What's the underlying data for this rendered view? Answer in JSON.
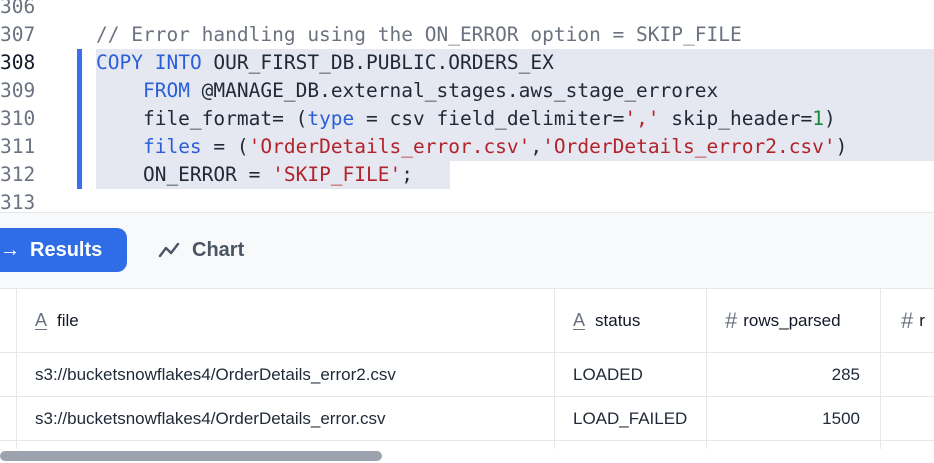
{
  "editor": {
    "lines": [
      {
        "num": "306",
        "text": ""
      },
      {
        "num": "307",
        "text": "// Error handling using the ON_ERROR option = SKIP_FILE"
      },
      {
        "num": "308",
        "p1": "COPY",
        "p2": " ",
        "p3": "INTO",
        "p4": " OUR_FIRST_DB.PUBLIC.ORDERS_EX"
      },
      {
        "num": "309",
        "p1": "    ",
        "p2": "FROM",
        "p3": " @MANAGE_DB.external_stages.aws_stage_errorex"
      },
      {
        "num": "310",
        "p1": "    file_format= (",
        "p2": "type",
        "p3": " = csv field_delimiter=",
        "p4": "','",
        "p5": " skip_header=",
        "p6": "1",
        "p7": ")"
      },
      {
        "num": "311",
        "p1": "    ",
        "p2": "files",
        "p3": " = (",
        "p4": "'OrderDetails_error.csv'",
        "p5": ",",
        "p6": "'OrderDetails_error2.csv'",
        "p7": ")"
      },
      {
        "num": "312",
        "p1": "    ON_ERROR = ",
        "p2": "'SKIP_FILE'",
        "p3": ";"
      },
      {
        "num": "313",
        "text": ""
      }
    ]
  },
  "results_panel": {
    "tabs": {
      "results": "Results",
      "results_icon": "→",
      "chart": "Chart"
    },
    "columns": [
      {
        "type_icon": "A",
        "name": "file"
      },
      {
        "type_icon": "A",
        "name": "status"
      },
      {
        "type_icon": "#",
        "name": "rows_parsed"
      },
      {
        "type_icon": "#",
        "name": "r"
      }
    ],
    "rows": [
      {
        "file": "s3://bucketsnowflakes4/OrderDetails_error2.csv",
        "status": "LOADED",
        "rows_parsed": "285"
      },
      {
        "file": "s3://bucketsnowflakes4/OrderDetails_error.csv",
        "status": "LOAD_FAILED",
        "rows_parsed": "1500"
      }
    ],
    "scrollbar_position": 0.0
  },
  "colors": {
    "accent": "#2e6de6",
    "keyword": "#2a5fd8",
    "string": "#b3232b",
    "number": "#138a3c",
    "selection": "#e5e8f0"
  }
}
